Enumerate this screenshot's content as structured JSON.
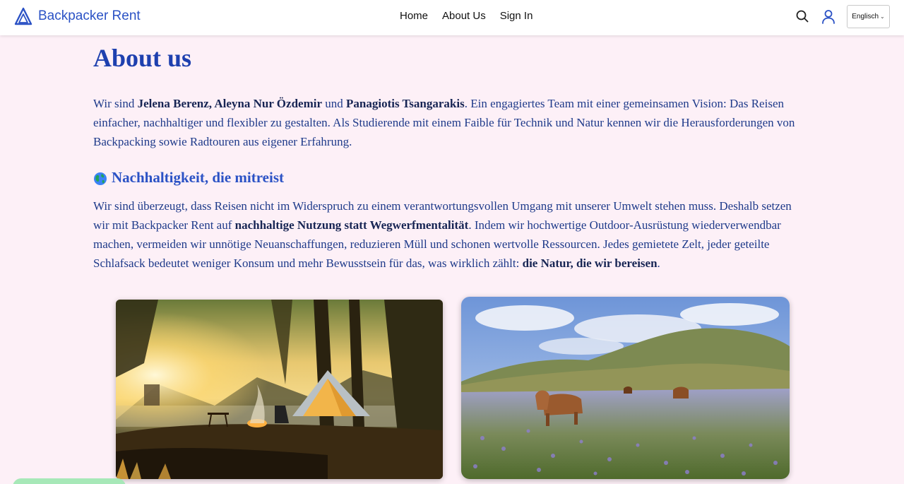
{
  "header": {
    "brand_name": "Backpacker Rent",
    "nav": [
      {
        "label": "Home"
      },
      {
        "label": "About Us"
      },
      {
        "label": "Sign In"
      }
    ],
    "language": "Englisch",
    "brand_color": "#2b52c5"
  },
  "main": {
    "title": "About us",
    "intro": {
      "p1": "Wir sind ",
      "b1": "Jelena Berenz, Aleyna Nur Özdemir",
      "p2": " und ",
      "b2": "Panagiotis Tsangarakis",
      "p3": ". Ein engagiertes Team mit einer gemeinsamen Vision: Das Reisen einfacher, nachhaltiger und flexibler zu gestalten. Als Studierende mit einem Faible für Technik und Natur kennen wir die Herausforderungen von Backpacking sowie Radtouren aus eigener Erfahrung."
    },
    "section_title": "Nachhaltigkeit, die mitreist",
    "section": {
      "p1": "Wir sind überzeugt, dass Reisen nicht im Widerspruch zu einem verantwortungsvollen Umgang mit unserer Umwelt stehen muss. Deshalb setzen wir mit Backpacker Rent auf ",
      "b1": "nachhaltige Nutzung statt Wegwerfmentalität",
      "p2": ". Indem wir hochwertige Outdoor-Ausrüstung wiederverwendbar machen, vermeiden wir unnötige Neuanschaffungen, reduzieren Müll und schonen wertvolle Ressourcen. Jedes gemietete Zelt, jeder geteilte Schlafsack bedeutet weniger Konsum und mehr Bewusstsein für das, was wirklich zählt: ",
      "b2": "die Natur, die wir bereisen",
      "p3": "."
    },
    "images": [
      {
        "name": "camping-photo"
      },
      {
        "name": "meadow-cows-photo"
      }
    ],
    "background_color": "#fdf0f7"
  }
}
